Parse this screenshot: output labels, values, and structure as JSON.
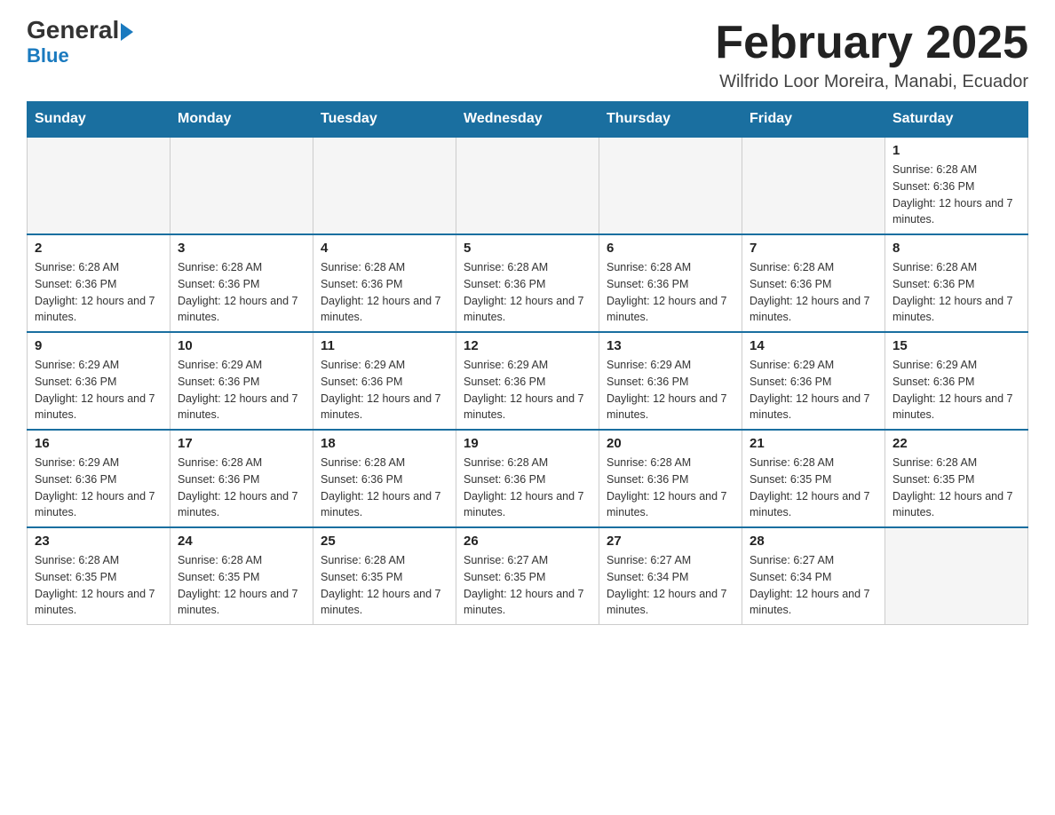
{
  "logo": {
    "line1_regular": "General",
    "line1_arrow": "▶",
    "line2": "Blue"
  },
  "header": {
    "month_title": "February 2025",
    "subtitle": "Wilfrido Loor Moreira, Manabi, Ecuador"
  },
  "days_of_week": [
    "Sunday",
    "Monday",
    "Tuesday",
    "Wednesday",
    "Thursday",
    "Friday",
    "Saturday"
  ],
  "weeks": [
    [
      {
        "day": "",
        "info": ""
      },
      {
        "day": "",
        "info": ""
      },
      {
        "day": "",
        "info": ""
      },
      {
        "day": "",
        "info": ""
      },
      {
        "day": "",
        "info": ""
      },
      {
        "day": "",
        "info": ""
      },
      {
        "day": "1",
        "info": "Sunrise: 6:28 AM\nSunset: 6:36 PM\nDaylight: 12 hours and 7 minutes."
      }
    ],
    [
      {
        "day": "2",
        "info": "Sunrise: 6:28 AM\nSunset: 6:36 PM\nDaylight: 12 hours and 7 minutes."
      },
      {
        "day": "3",
        "info": "Sunrise: 6:28 AM\nSunset: 6:36 PM\nDaylight: 12 hours and 7 minutes."
      },
      {
        "day": "4",
        "info": "Sunrise: 6:28 AM\nSunset: 6:36 PM\nDaylight: 12 hours and 7 minutes."
      },
      {
        "day": "5",
        "info": "Sunrise: 6:28 AM\nSunset: 6:36 PM\nDaylight: 12 hours and 7 minutes."
      },
      {
        "day": "6",
        "info": "Sunrise: 6:28 AM\nSunset: 6:36 PM\nDaylight: 12 hours and 7 minutes."
      },
      {
        "day": "7",
        "info": "Sunrise: 6:28 AM\nSunset: 6:36 PM\nDaylight: 12 hours and 7 minutes."
      },
      {
        "day": "8",
        "info": "Sunrise: 6:28 AM\nSunset: 6:36 PM\nDaylight: 12 hours and 7 minutes."
      }
    ],
    [
      {
        "day": "9",
        "info": "Sunrise: 6:29 AM\nSunset: 6:36 PM\nDaylight: 12 hours and 7 minutes."
      },
      {
        "day": "10",
        "info": "Sunrise: 6:29 AM\nSunset: 6:36 PM\nDaylight: 12 hours and 7 minutes."
      },
      {
        "day": "11",
        "info": "Sunrise: 6:29 AM\nSunset: 6:36 PM\nDaylight: 12 hours and 7 minutes."
      },
      {
        "day": "12",
        "info": "Sunrise: 6:29 AM\nSunset: 6:36 PM\nDaylight: 12 hours and 7 minutes."
      },
      {
        "day": "13",
        "info": "Sunrise: 6:29 AM\nSunset: 6:36 PM\nDaylight: 12 hours and 7 minutes."
      },
      {
        "day": "14",
        "info": "Sunrise: 6:29 AM\nSunset: 6:36 PM\nDaylight: 12 hours and 7 minutes."
      },
      {
        "day": "15",
        "info": "Sunrise: 6:29 AM\nSunset: 6:36 PM\nDaylight: 12 hours and 7 minutes."
      }
    ],
    [
      {
        "day": "16",
        "info": "Sunrise: 6:29 AM\nSunset: 6:36 PM\nDaylight: 12 hours and 7 minutes."
      },
      {
        "day": "17",
        "info": "Sunrise: 6:28 AM\nSunset: 6:36 PM\nDaylight: 12 hours and 7 minutes."
      },
      {
        "day": "18",
        "info": "Sunrise: 6:28 AM\nSunset: 6:36 PM\nDaylight: 12 hours and 7 minutes."
      },
      {
        "day": "19",
        "info": "Sunrise: 6:28 AM\nSunset: 6:36 PM\nDaylight: 12 hours and 7 minutes."
      },
      {
        "day": "20",
        "info": "Sunrise: 6:28 AM\nSunset: 6:36 PM\nDaylight: 12 hours and 7 minutes."
      },
      {
        "day": "21",
        "info": "Sunrise: 6:28 AM\nSunset: 6:35 PM\nDaylight: 12 hours and 7 minutes."
      },
      {
        "day": "22",
        "info": "Sunrise: 6:28 AM\nSunset: 6:35 PM\nDaylight: 12 hours and 7 minutes."
      }
    ],
    [
      {
        "day": "23",
        "info": "Sunrise: 6:28 AM\nSunset: 6:35 PM\nDaylight: 12 hours and 7 minutes."
      },
      {
        "day": "24",
        "info": "Sunrise: 6:28 AM\nSunset: 6:35 PM\nDaylight: 12 hours and 7 minutes."
      },
      {
        "day": "25",
        "info": "Sunrise: 6:28 AM\nSunset: 6:35 PM\nDaylight: 12 hours and 7 minutes."
      },
      {
        "day": "26",
        "info": "Sunrise: 6:27 AM\nSunset: 6:35 PM\nDaylight: 12 hours and 7 minutes."
      },
      {
        "day": "27",
        "info": "Sunrise: 6:27 AM\nSunset: 6:34 PM\nDaylight: 12 hours and 7 minutes."
      },
      {
        "day": "28",
        "info": "Sunrise: 6:27 AM\nSunset: 6:34 PM\nDaylight: 12 hours and 7 minutes."
      },
      {
        "day": "",
        "info": ""
      }
    ]
  ]
}
